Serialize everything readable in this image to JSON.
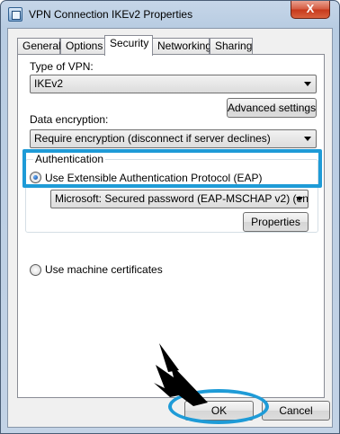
{
  "window": {
    "title": "VPN Connection IKEv2 Properties",
    "close_glyph": "X"
  },
  "tabs": [
    {
      "label": "General"
    },
    {
      "label": "Options"
    },
    {
      "label": "Security"
    },
    {
      "label": "Networking"
    },
    {
      "label": "Sharing"
    }
  ],
  "active_tab": "Security",
  "security": {
    "vpn_type_label": "Type of VPN:",
    "vpn_type_value": "IKEv2",
    "advanced_button": "Advanced settings",
    "encryption_label": "Data encryption:",
    "encryption_value": "Require encryption (disconnect if server declines)",
    "auth_group_title": "Authentication",
    "eap_option": "Use Extensible Authentication Protocol (EAP)",
    "eap_method_value": "Microsoft: Secured password (EAP-MSCHAP v2) (encryp",
    "properties_button": "Properties",
    "machine_cert_option": "Use machine certificates",
    "selected_auth": "eap"
  },
  "buttons": {
    "ok": "OK",
    "cancel": "Cancel"
  },
  "annotations": {
    "highlight_color": "#1e9bd7",
    "arrow_color": "#000000"
  },
  "icons": [
    "window-icon",
    "close-icon",
    "dropdown-arrow-icon",
    "pointer-arrow-icon"
  ]
}
